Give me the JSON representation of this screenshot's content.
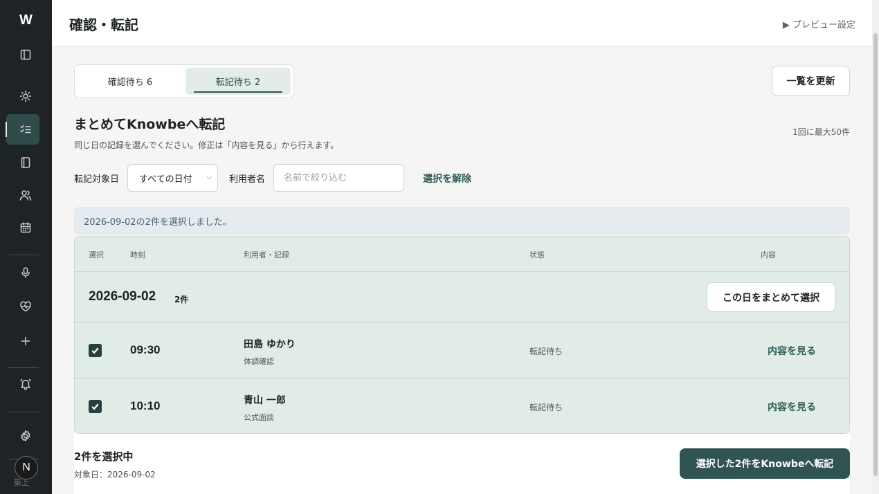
{
  "app": {
    "logo": "W"
  },
  "header": {
    "title": "確認・転記",
    "preview_link": "▶ プレビュー設定"
  },
  "sidebar": {
    "items": [
      {
        "icon": "panel-toggle-icon"
      },
      {
        "icon": "sun-icon"
      },
      {
        "icon": "checklist-icon",
        "active": true
      },
      {
        "icon": "notebook-icon"
      },
      {
        "icon": "users-icon"
      },
      {
        "icon": "calendar-icon"
      },
      {
        "icon": "microphone-icon"
      },
      {
        "icon": "heart-pulse-icon"
      },
      {
        "icon": "plus-icon"
      },
      {
        "icon": "bell-icon"
      },
      {
        "icon": "gear-icon"
      }
    ],
    "avatar_initial": "N",
    "avatar_caption": "築上"
  },
  "tabs": [
    {
      "label": "確認待ち 6",
      "active": false
    },
    {
      "label": "転記待ち 2",
      "active": true
    }
  ],
  "toolbar": {
    "refresh_label": "一覧を更新"
  },
  "section": {
    "title": "まとめてKnowbeへ転記",
    "subtitle": "同じ日の記録を選んでください。修正は「内容を見る」から行えます。",
    "max_note": "1回に最大50件"
  },
  "filters": {
    "date_label": "転記対象日",
    "date_value": "すべての日付",
    "name_label": "利用者名",
    "name_placeholder": "名前で絞り込む",
    "clear_label": "選択を解除"
  },
  "banner": {
    "text": "2026-09-02の2件を選択しました。"
  },
  "table": {
    "headers": {
      "select": "選択",
      "time": "時刻",
      "user": "利用者・記録",
      "status": "状態",
      "content": "内容"
    },
    "group": {
      "date": "2026-09-02",
      "count": "2件",
      "select_day_label": "この日をまとめて選択"
    },
    "rows": [
      {
        "checked": true,
        "time": "09:30",
        "name": "田島 ゆかり",
        "record": "体調確認",
        "status": "転記待ち",
        "action": "内容を見る"
      },
      {
        "checked": true,
        "time": "10:10",
        "name": "青山 一郎",
        "record": "公式面談",
        "status": "転記待ち",
        "action": "内容を見る"
      }
    ]
  },
  "footer": {
    "selected": "2件を選択中",
    "target_date": "対象日：2026-09-02",
    "submit_label": "選択した2件をKnowbeへ転記"
  },
  "colors": {
    "sidebar": "#1e2426",
    "accent": "#2f5451",
    "table_bg": "#e1ece6",
    "banner_bg": "#e5ebee"
  }
}
